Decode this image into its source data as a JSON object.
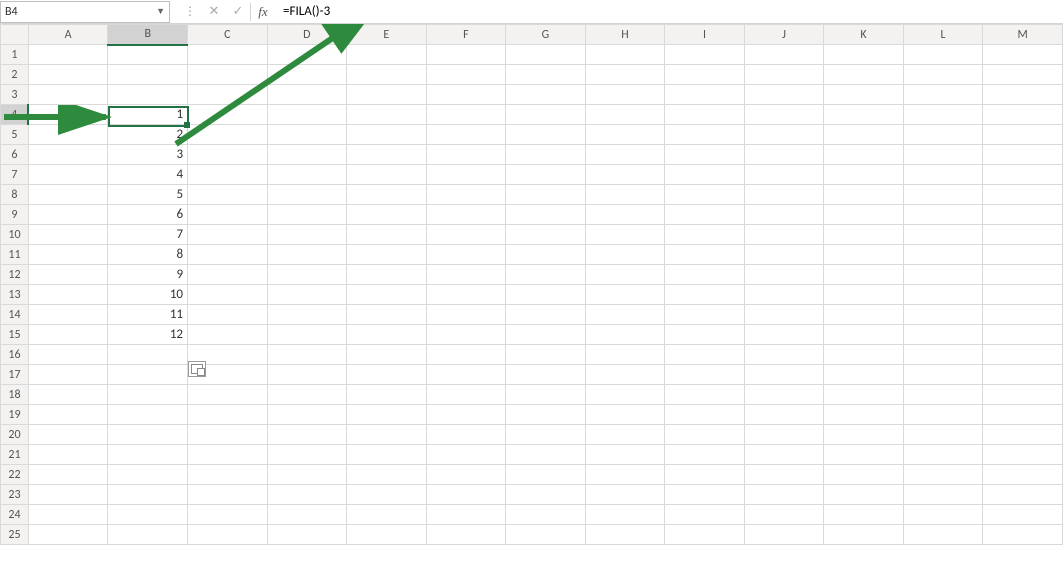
{
  "nameBox": {
    "value": "B4"
  },
  "formulaBar": {
    "value": "=FILA()-3"
  },
  "columns": [
    "A",
    "B",
    "C",
    "D",
    "E",
    "F",
    "G",
    "H",
    "I",
    "J",
    "K",
    "L",
    "M"
  ],
  "rows": [
    1,
    2,
    3,
    4,
    5,
    6,
    7,
    8,
    9,
    10,
    11,
    12,
    13,
    14,
    15,
    16,
    17,
    18,
    19,
    20,
    21,
    22,
    23,
    24,
    25
  ],
  "activeCol": "B",
  "activeRow": 4,
  "cells": {
    "B4": "1",
    "B5": "2",
    "B6": "3",
    "B7": "4",
    "B8": "5",
    "B9": "6",
    "B10": "7",
    "B11": "8",
    "B12": "9",
    "B13": "10",
    "B14": "11",
    "B15": "12"
  },
  "annotations": {
    "arrowColor": "#2e8b3d"
  }
}
